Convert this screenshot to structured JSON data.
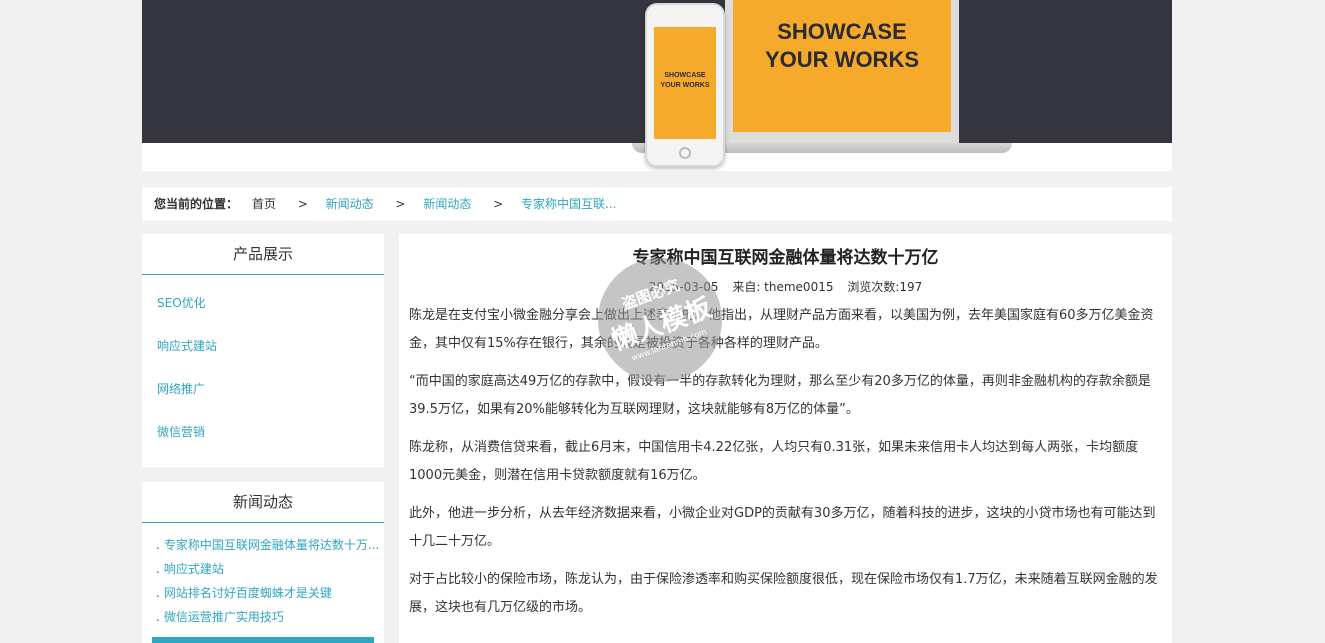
{
  "banner": {
    "laptop_text": "SHOWCASE\nYOUR WORKS",
    "phone_text": "SHOWCASE\nYOUR WORKS"
  },
  "breadcrumb": {
    "lead": "您当前的位置：",
    "items": [
      "首页",
      "新闻动态",
      "新闻动态",
      "专家称中国互联..."
    ],
    "separator": ">"
  },
  "sidebar": {
    "products": {
      "title": "产品展示",
      "items": [
        "SEO优化",
        "响应式建站",
        "网络推广",
        "微信营销"
      ]
    },
    "news": {
      "title": "新闻动态",
      "bullet": ".",
      "items": [
        "专家称中国互联网金融体量将达数十万...",
        "响应式建站",
        "网站排名讨好百度蜘蛛才是关键",
        "微信运营推广实用技巧"
      ]
    }
  },
  "article": {
    "title": "专家称中国互联网金融体量将达数十万亿",
    "date": "2015-03-05",
    "source": "来自: theme0015",
    "views": "浏览次数:197",
    "paragraphs": [
      "陈龙是在支付宝小微金融分享会上做出上述表示的。他指出，从理财产品方面来看，以美国为例，去年美国家庭有60多万亿美金资金，其中仅有15%存在银行，其余的钱是被投资于各种各样的理财产品。",
      "“而中国的家庭高达49万亿的存款中，假设有一半的存款转化为理财，那么至少有20多万亿的体量，再则非金融机构的存款余额是39.5万亿，如果有20%能够转化为互联网理财，这块就能够有8万亿的体量”。",
      "陈龙称，从消费信贷来看，截止6月末，中国信用卡4.22亿张，人均只有0.31张，如果未来信用卡人均达到每人两张，卡均额度1000元美金，则潜在信用卡贷款额度就有16万亿。",
      "此外，他进一步分析，从去年经济数据来看，小微企业对GDP的贡献有30多万亿，随着科技的进步，这块的小贷市场也有可能达到十几二十万亿。",
      "对于占比较小的保险市场，陈龙认为，由于保险渗透率和购买保险额度很低，现在保险市场仅有1.7万亿，未来随着互联网金融的发展，这块也有几万亿级的市场。"
    ]
  },
  "watermark": {
    "top": "盗图必究",
    "main": "懒人模板",
    "url": "www.lanrenmb.com"
  },
  "colors": {
    "accent": "#30a7c0",
    "banner_dark": "#34353f",
    "showcase_orange": "#f6aa2b"
  }
}
